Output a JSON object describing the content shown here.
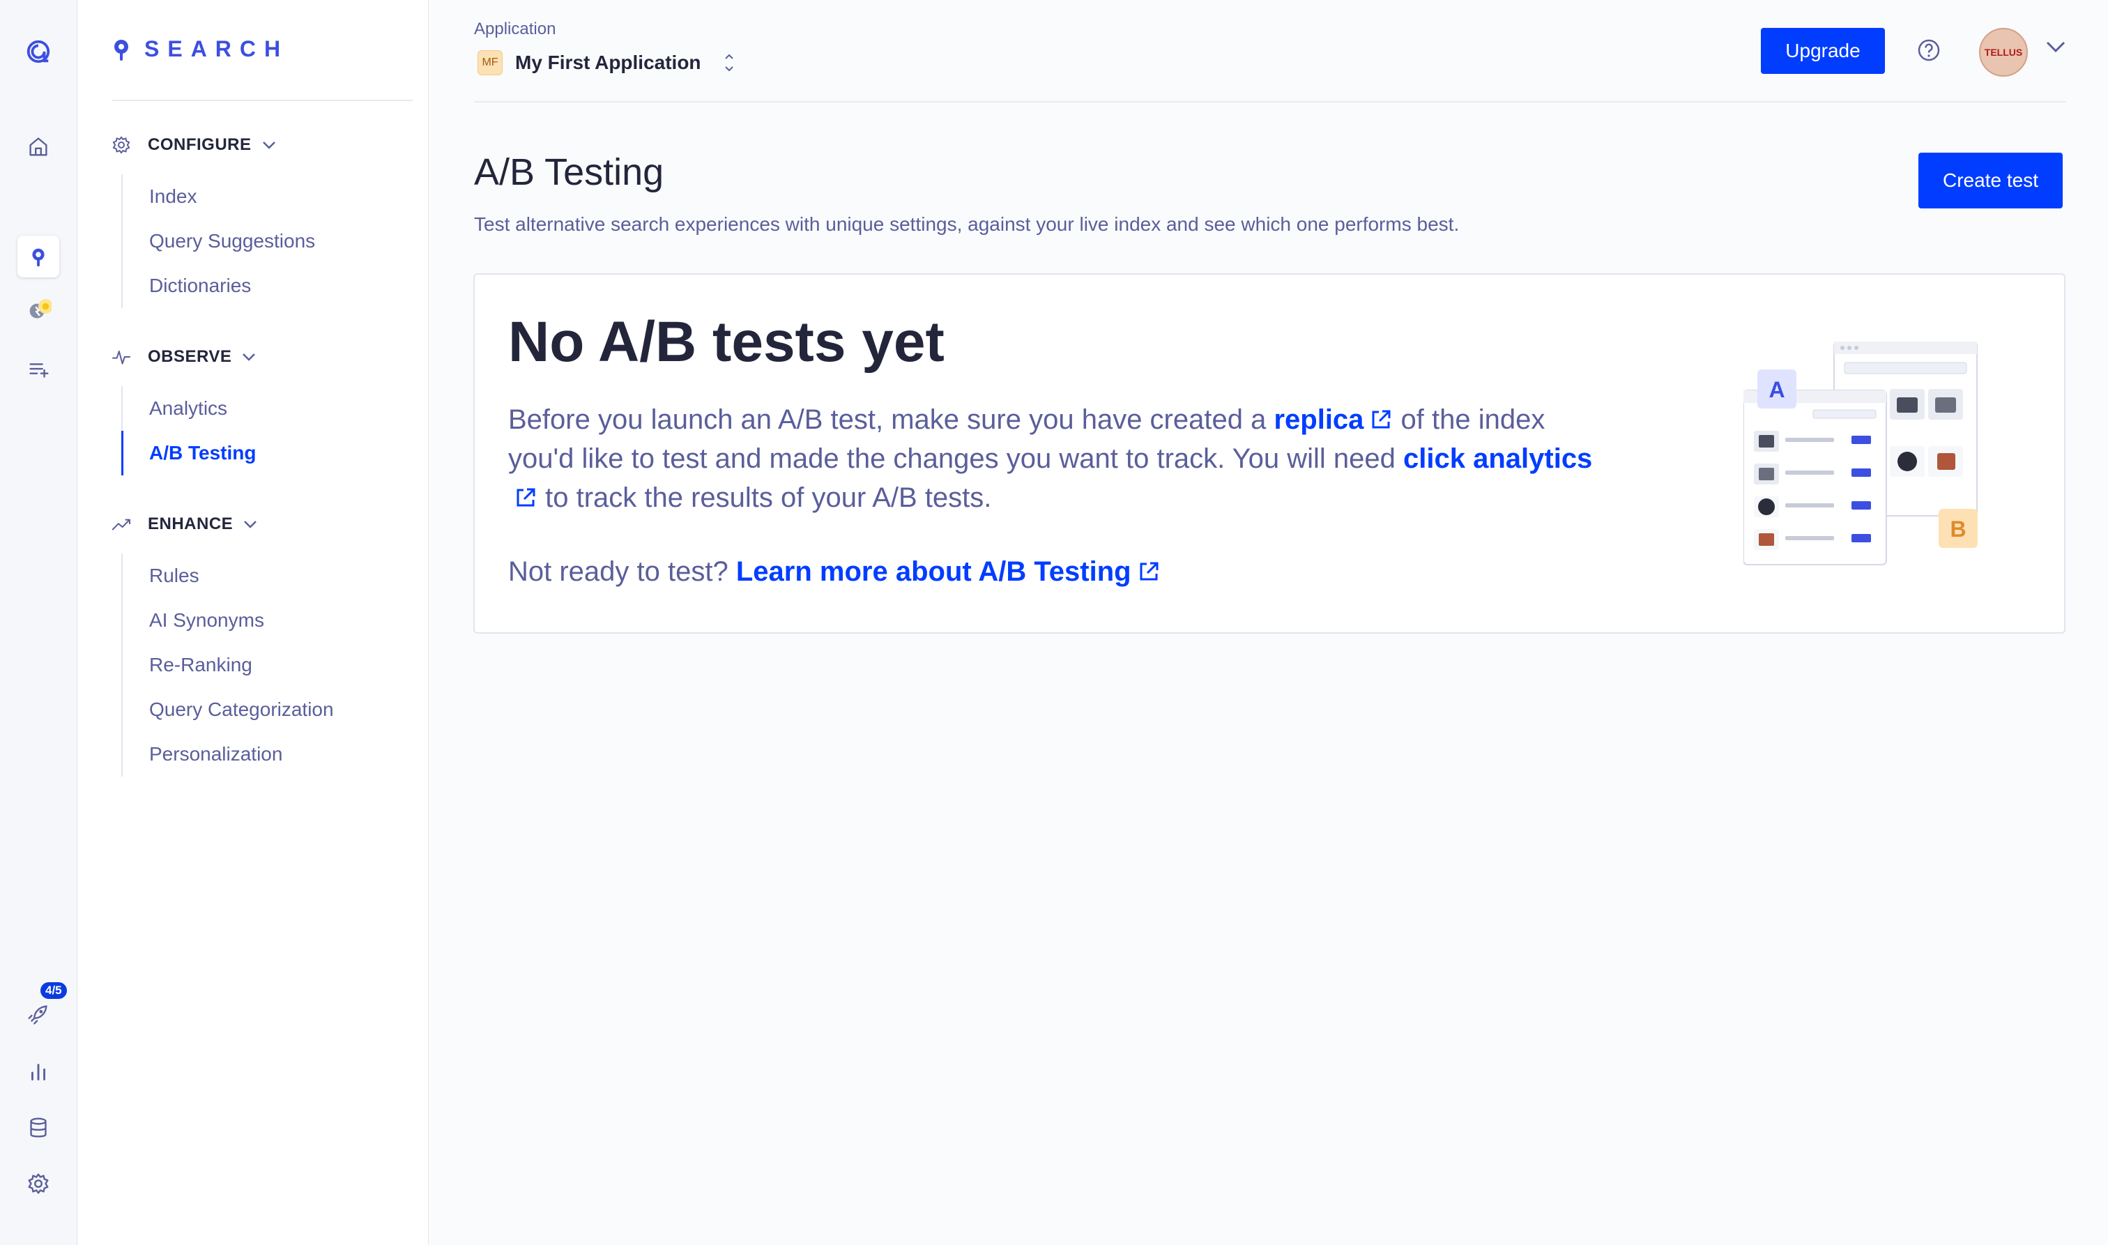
{
  "rail": {
    "items": [
      "logo",
      "home",
      "search",
      "quick-start",
      "list",
      "rocket",
      "analytics",
      "database",
      "settings"
    ],
    "rocket_badge": "4/5"
  },
  "sidebar": {
    "product_name": "SEARCH",
    "sections": [
      {
        "title": "CONFIGURE",
        "items": [
          "Index",
          "Query Suggestions",
          "Dictionaries"
        ]
      },
      {
        "title": "OBSERVE",
        "items": [
          "Analytics",
          "A/B Testing"
        ]
      },
      {
        "title": "ENHANCE",
        "items": [
          "Rules",
          "AI Synonyms",
          "Re-Ranking",
          "Query Categorization",
          "Personalization"
        ]
      }
    ],
    "active_item": "A/B Testing"
  },
  "topbar": {
    "app_label": "Application",
    "app_initials": "MF",
    "app_name": "My First Application",
    "upgrade_label": "Upgrade",
    "avatar_text": "TELLUS"
  },
  "page": {
    "title": "A/B Testing",
    "description": "Test alternative search experiences with unique settings, against your live index and see which one performs best.",
    "create_label": "Create test"
  },
  "empty_state": {
    "title": "No A/B tests yet",
    "body_1": "Before you launch an A/B test, make sure you have created a",
    "link_replica": "replica",
    "body_2": "of the index you'd like to test and made the changes you want to track. You will need",
    "link_analytics": "click analytics",
    "body_3": "to track the results of your A/B tests.",
    "foot_text": "Not ready to test?",
    "foot_link": "Learn more about A/B Testing",
    "illustration_labels": {
      "a": "A",
      "b": "B"
    }
  },
  "colors": {
    "accent": "#003dff",
    "brand": "#3c4fe0",
    "text": "#23263b",
    "muted": "#5a5e9a"
  }
}
